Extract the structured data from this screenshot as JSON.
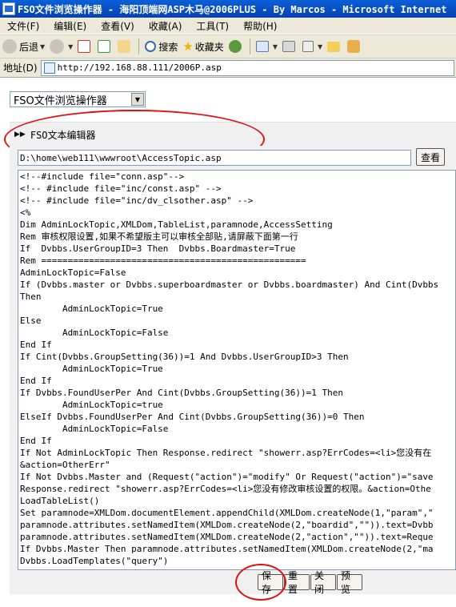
{
  "window": {
    "title": "FSO文件浏览操作器 - 海阳顶端网ASP木马@2006PLUS - By Marcos - Microsoft Internet"
  },
  "menu": [
    "文件(F)",
    "编辑(E)",
    "查看(V)",
    "收藏(A)",
    "工具(T)",
    "帮助(H)"
  ],
  "toolbar": {
    "back": "后退",
    "search": "搜索",
    "favorites": "收藏夹"
  },
  "address": {
    "label": "地址(D)",
    "url": "http://192.168.88.111/2006P.asp"
  },
  "page": {
    "mode_select": "FSO文件浏览操作器",
    "section_title": "FSO文本编辑器",
    "path_value": "D:\\home\\web111\\wwwroot\\AccessTopic.asp",
    "view_button": "查看",
    "code_lines": [
      "<!--#include file=\"conn.asp\"-->",
      "<!-- #include file=\"inc/const.asp\" -->",
      "<!-- #include file=\"inc/dv_clsother.asp\" -->",
      "<%",
      "Dim AdminLockTopic,XMLDom,TableList,paramnode,AccessSetting",
      "Rem 审核权限设置,如果不希望版主可以审核全部贴,请屏蔽下面第一行",
      "If  Dvbbs.UserGroupID=3 Then  Dvbbs.Boardmaster=True",
      "Rem ==================================================",
      "AdminLockTopic=False",
      "If (Dvbbs.master or Dvbbs.superboardmaster or Dvbbs.boardmaster) And Cint(Dvbbs",
      "Then",
      "        AdminLockTopic=True",
      "Else",
      "        AdminLockTopic=False",
      "End If",
      "If Cint(Dvbbs.GroupSetting(36))=1 And Dvbbs.UserGroupID>3 Then",
      "        AdminLockTopic=True",
      "End If",
      "If Dvbbs.FoundUserPer And Cint(Dvbbs.GroupSetting(36))=1 Then",
      "        AdminLockTopic=true",
      "ElseIf Dvbbs.FoundUserPer And Cint(Dvbbs.GroupSetting(36))=0 Then",
      "        AdminLockTopic=False",
      "End If",
      "If Not AdminLockTopic Then Response.redirect \"showerr.asp?ErrCodes=<li>您没有在",
      "&action=OtherErr\"",
      "If Not Dvbbs.Master and (Request(\"action\")=\"modify\" Or Request(\"action\")=\"save",
      "Response.redirect \"showerr.asp?ErrCodes=<li>您没有修改审核设置的权限。&action=Othe",
      "LoadTableList()",
      "Set paramnode=XMLDom.documentElement.appendChild(XMLDom.createNode(1,\"param\",\"",
      "paramnode.attributes.setNamedItem(XMLDom.createNode(2,\"boardid\",\"\")).text=Dvbb",
      "paramnode.attributes.setNamedItem(XMLDom.createNode(2,\"action\",\"\")).text=Reque",
      "If Dvbbs.Master Then paramnode.attributes.setNamedItem(XMLDom.createNode(2,\"ma",
      "Dvbbs.LoadTemplates(\"query\")"
    ],
    "buttons": {
      "save": "保存",
      "reset": "重置",
      "close": "关闭",
      "preview": "预览"
    }
  },
  "colors": {
    "title_bar": "#0a5fd8",
    "annotation": "#e01010",
    "panel": "#f0f0f0"
  }
}
